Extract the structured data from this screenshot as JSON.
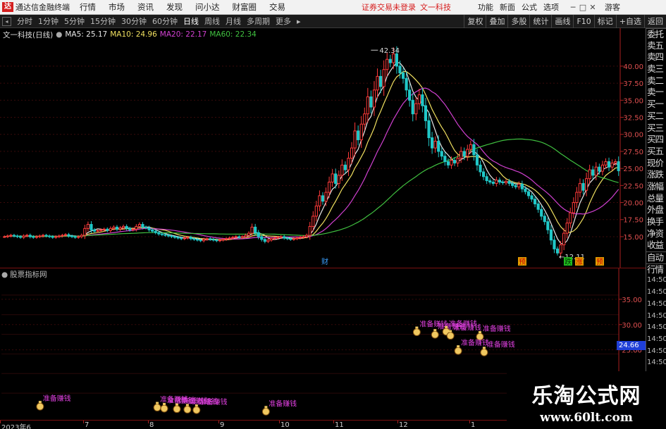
{
  "topbar": {
    "app_title": "通达信金融终端",
    "menu": [
      "行情",
      "市场",
      "资讯",
      "发现",
      "问小达",
      "财富圈",
      "交易"
    ],
    "login_status": "证券交易未登录",
    "stock_name": "文一科技",
    "tools": [
      "功能",
      "新面",
      "公式",
      "选项"
    ],
    "guest": "游客"
  },
  "periods": {
    "items": [
      "分时",
      "1分钟",
      "5分钟",
      "15分钟",
      "30分钟",
      "60分钟",
      "日线",
      "周线",
      "月线",
      "多周期",
      "更多"
    ],
    "active": "日线",
    "right_buttons": [
      "复权",
      "叠加",
      "多股",
      "统计",
      "画线",
      "F10",
      "标记",
      "+自选",
      "返回"
    ]
  },
  "main": {
    "stock_title": "文一科技(日线)",
    "ma5": "MA5: 25.17",
    "ma10": "MA10: 24.96",
    "ma20": "MA20: 22.17",
    "ma60": "MA60: 22.34",
    "colors": {
      "ma5": "#e8e8e8",
      "ma10": "#f0e060",
      "ma20": "#d040d0",
      "ma60": "#40c040",
      "up": "#ff3a3a",
      "down": "#20c8c8"
    },
    "high_label": "42.34",
    "low_label": "12.11",
    "event_markers": [
      "财",
      "预",
      "跌",
      "涨",
      "预"
    ]
  },
  "right_panel": {
    "items": [
      "委托",
      "卖五",
      "卖四",
      "卖三",
      "卖二",
      "卖一",
      "买一",
      "买二",
      "买三",
      "买四",
      "买五",
      "现价",
      "涨跌",
      "涨幅",
      "总量",
      "外盘",
      "换手",
      "净资",
      "收益",
      "自动",
      "行情"
    ],
    "times": [
      "14:50",
      "14:50",
      "14:50",
      "14:50",
      "14:50",
      "14:50",
      "14:50",
      "14:50",
      "14:50"
    ]
  },
  "indicator": {
    "title": "股票指标网",
    "price_box": "24.66",
    "signal_label": "准备赚钱"
  },
  "xaxis": {
    "labels": [
      "2023年6",
      "7",
      "8",
      "9",
      "10",
      "11",
      "12",
      "1"
    ]
  },
  "watermark": {
    "title": "乐淘公式网",
    "url": "www.60lt.com"
  },
  "chart_data": {
    "type": "candlestick",
    "title": "文一科技(日线)",
    "y_ticks": [
      15.0,
      17.5,
      20.0,
      22.5,
      25.0,
      27.5,
      30.0,
      32.5,
      35.0,
      37.5,
      40.0
    ],
    "ylim": [
      12.0,
      43.5
    ],
    "indicator_y_ticks": [
      25.0,
      30.0,
      35.0
    ],
    "indicator_ylim": [
      12.0,
      40.0
    ],
    "high": 42.34,
    "low": 12.11,
    "months": [
      "2023年6",
      "7",
      "8",
      "9",
      "10",
      "11",
      "12",
      "1"
    ],
    "close": [
      15.0,
      15.1,
      15.2,
      15.1,
      15.0,
      14.9,
      15.1,
      15.2,
      15.0,
      14.9,
      15.0,
      15.1,
      15.2,
      15.1,
      15.0,
      14.9,
      15.0,
      15.1,
      15.2,
      15.3,
      15.1,
      15.0,
      14.9,
      15.0,
      15.2,
      16.2,
      16.8,
      16.0,
      15.8,
      15.9,
      16.0,
      16.1,
      15.9,
      16.2,
      16.4,
      16.1,
      16.3,
      16.5,
      16.2,
      16.0,
      16.1,
      16.5,
      16.8,
      16.4,
      16.3,
      16.0,
      15.8,
      15.6,
      15.4,
      15.3,
      15.2,
      15.1,
      15.0,
      14.9,
      14.8,
      14.7,
      14.8,
      14.9,
      14.7,
      14.6,
      14.5,
      14.4,
      14.6,
      14.7,
      14.6,
      14.5,
      14.4,
      14.5,
      14.6,
      14.7,
      14.8,
      14.9,
      15.0,
      14.9,
      15.0,
      15.2,
      15.5,
      16.4,
      15.6,
      15.0,
      14.6,
      14.3,
      14.5,
      14.7,
      14.8,
      14.9,
      15.0,
      14.8,
      14.7,
      14.6,
      14.7,
      14.8,
      14.9,
      15.0,
      15.2,
      16.5,
      18.0,
      19.5,
      21.0,
      20.2,
      21.5,
      23.0,
      24.2,
      22.8,
      24.0,
      25.5,
      24.8,
      26.5,
      28.0,
      30.5,
      29.2,
      31.5,
      33.0,
      35.5,
      34.0,
      36.5,
      38.5,
      37.0,
      39.5,
      41.0,
      40.5,
      41.8,
      40.0,
      39.0,
      38.2,
      36.5,
      35.0,
      33.0,
      34.5,
      35.8,
      34.2,
      32.0,
      29.5,
      28.0,
      29.0,
      27.5,
      26.8,
      26.0,
      25.5,
      26.2,
      25.8,
      26.5,
      27.5,
      26.8,
      27.8,
      28.5,
      27.0,
      25.5,
      24.5,
      23.8,
      23.2,
      23.0,
      22.8,
      23.3,
      23.0,
      22.9,
      23.1,
      22.8,
      22.5,
      22.3,
      22.7,
      22.0,
      21.6,
      21.0,
      20.5,
      19.8,
      19.0,
      18.0,
      17.2,
      16.0,
      14.5,
      13.2,
      12.6,
      13.8,
      15.5,
      17.0,
      18.5,
      20.0,
      21.5,
      22.8,
      21.8,
      23.5,
      24.8,
      24.0,
      25.2,
      24.6,
      25.5,
      26.0,
      25.2,
      25.8,
      26.0,
      24.66
    ],
    "signals_y": [
      13.8,
      13.6,
      13.4,
      13.3,
      13.2,
      13.1,
      12.8,
      28.5,
      28.0,
      28.6,
      27.8,
      27.6,
      24.5,
      24.8
    ]
  }
}
